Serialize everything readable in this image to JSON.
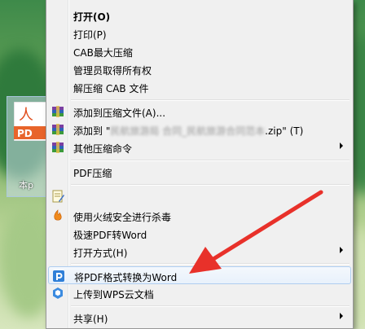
{
  "desktop": {
    "file_caption": "本p"
  },
  "menu": {
    "open": "打开(O)",
    "print": "打印(P)",
    "cab_max": "CAB最大压缩",
    "admin_own": "管理员取得所有权",
    "extract_cab": "解压缩 CAB 文件",
    "add_archive": "添加到压缩文件(A)...",
    "add_to_prefix": "添加到 \"",
    "add_to_hidden": "民航旅游局 合同_民航旅游合同范本",
    "add_to_suffix": ".zip\" (T)",
    "other_compress": "其他压缩命令",
    "pdf_compress": "PDF压缩",
    "scan_huorong": "使用火绒安全进行杀毒",
    "fast_pdf_word": "极速PDF转Word",
    "open_with": "打开方式(H)",
    "convert_pdf_word": "将PDF格式转换为Word",
    "upload_wps": "上传到WPS云文档",
    "share": "共享(H)"
  },
  "colors": {
    "arrow": "#e8312a",
    "highlight_border": "#aecdf0"
  }
}
